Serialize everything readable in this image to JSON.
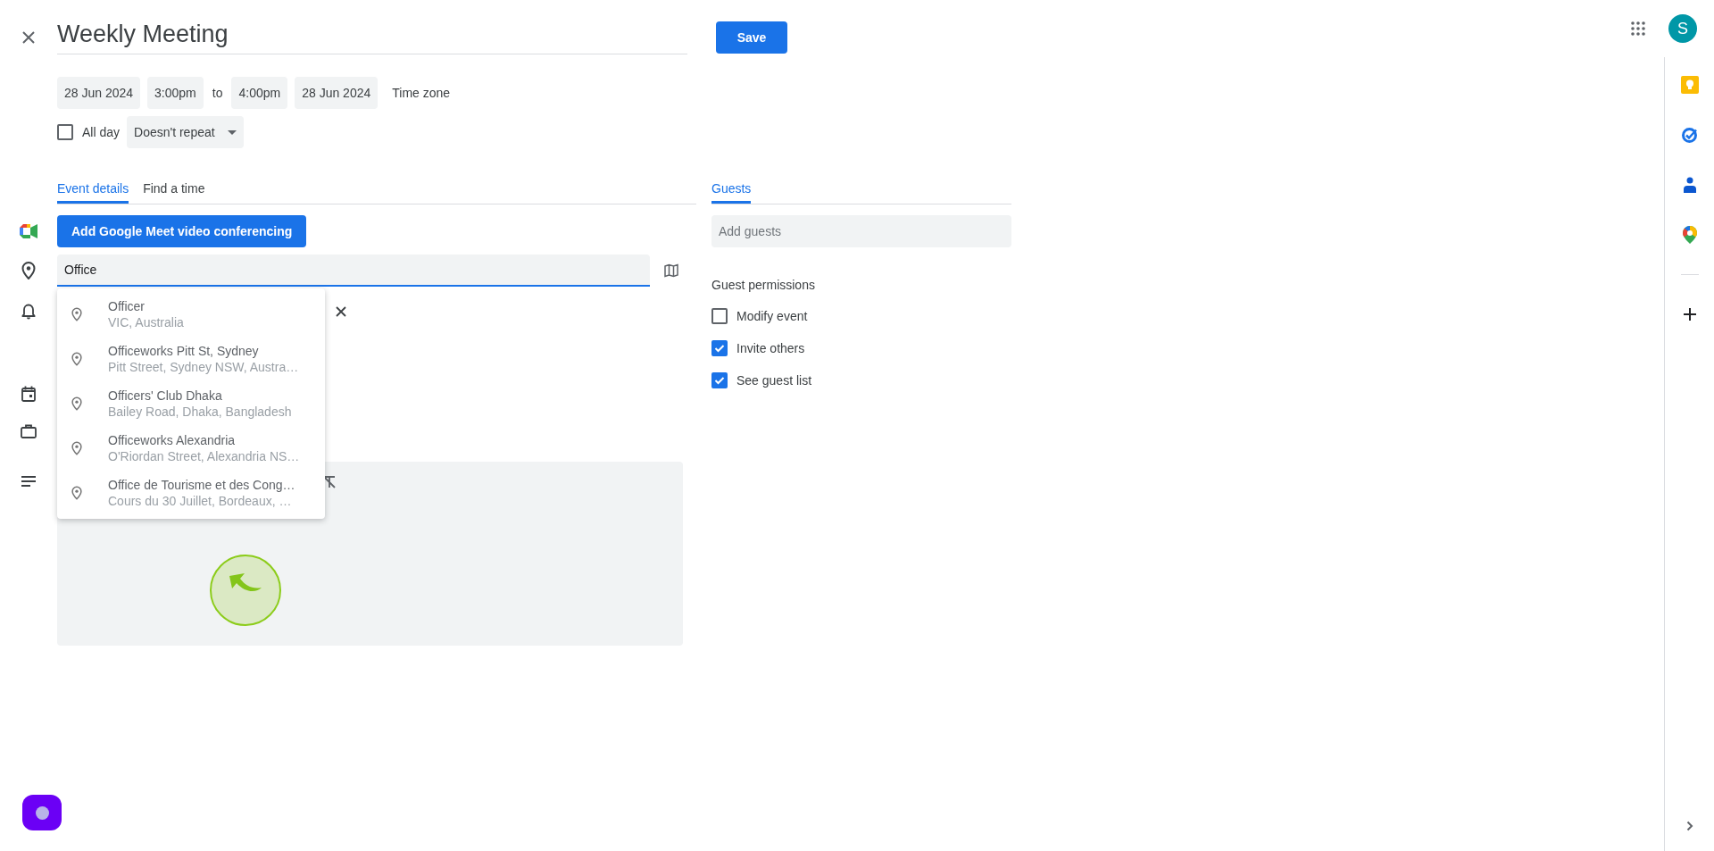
{
  "title": "Weekly Meeting",
  "save_button": "Save",
  "schedule": {
    "start_date": "28 Jun 2024",
    "start_time": "3:00pm",
    "separator": "to",
    "end_time": "4:00pm",
    "end_date": "28 Jun 2024",
    "time_zone_button": "Time zone"
  },
  "all_day": {
    "label": "All day",
    "checked": false
  },
  "repeat": "Doesn't repeat",
  "tabs": [
    {
      "label": "Event details",
      "selected": true
    },
    {
      "label": "Find a time",
      "selected": false
    }
  ],
  "meet_button": "Add Google Meet video conferencing",
  "location": {
    "value": "Office"
  },
  "location_suggestions": [
    {
      "name": "Officer",
      "address": "VIC, Australia"
    },
    {
      "name": "Officeworks Pitt St, Sydney",
      "address": "Pitt Street, Sydney NSW, Austra…"
    },
    {
      "name": "Officers' Club Dhaka",
      "address": "Bailey Road, Dhaka, Bangladesh"
    },
    {
      "name": "Officeworks Alexandria",
      "address": "O'Riordan Street, Alexandria NS…"
    },
    {
      "name": "Office de Tourisme et des Cong…",
      "address": "Cours du 30 Juillet, Bordeaux, …"
    }
  ],
  "guests": {
    "tab": {
      "label": "Guests",
      "selected": true
    },
    "placeholder": "Add guests",
    "permissions_title": "Guest permissions",
    "permissions": [
      {
        "label": "Modify event",
        "checked": false
      },
      {
        "label": "Invite others",
        "checked": true
      },
      {
        "label": "See guest list",
        "checked": true
      }
    ]
  },
  "account": {
    "initial": "S"
  }
}
